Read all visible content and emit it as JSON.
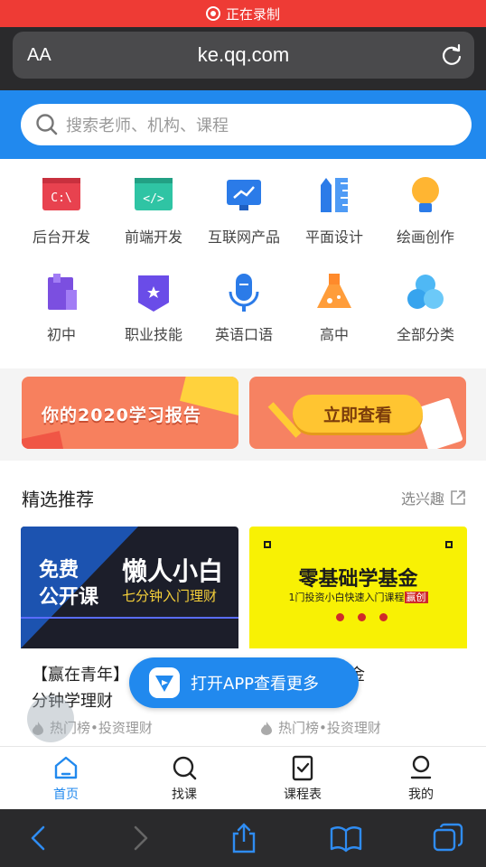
{
  "status_bar": {
    "recording_label": "正在录制",
    "color": "#ee3b35"
  },
  "browser": {
    "text_size_label": "AA",
    "url": "ke.qq.com"
  },
  "search": {
    "placeholder": "搜索老师、机构、课程"
  },
  "categories": [
    {
      "label": "后台开发",
      "icon": "terminal-icon"
    },
    {
      "label": "前端开发",
      "icon": "code-icon"
    },
    {
      "label": "互联网产品",
      "icon": "chart-icon"
    },
    {
      "label": "平面设计",
      "icon": "ruler-icon"
    },
    {
      "label": "绘画创作",
      "icon": "bulb-icon"
    },
    {
      "label": "初中",
      "icon": "book-icon"
    },
    {
      "label": "职业技能",
      "icon": "badge-icon"
    },
    {
      "label": "英语口语",
      "icon": "microphone-icon"
    },
    {
      "label": "高中",
      "icon": "flask-icon"
    },
    {
      "label": "全部分类",
      "icon": "cluster-icon"
    }
  ],
  "banners": {
    "report": "你的2020学习报告",
    "view_button": "立即查看"
  },
  "feed": {
    "title": "精选推荐",
    "more_label": "选兴趣",
    "cards": [
      {
        "thumb_left_1": "免费",
        "thumb_left_2": "公开课",
        "thumb_right_1": "懒人小白",
        "thumb_right_2": "七分钟入门理财",
        "title_line1": "【赢在青年】",
        "title_line2": "分钟学理财",
        "tag": "热门榜•投资理财"
      },
      {
        "thumb_title": "零基础学基金",
        "thumb_sub": "1门投资小白快速入门课程",
        "thumb_badge": "赢创",
        "title_line1": "金",
        "tag": "热门榜•投资理财"
      }
    ]
  },
  "open_app": {
    "label": "打开APP查看更多"
  },
  "tabbar": [
    {
      "label": "首页",
      "icon": "home-icon",
      "active": true
    },
    {
      "label": "找课",
      "icon": "search-icon",
      "active": false
    },
    {
      "label": "课程表",
      "icon": "schedule-icon",
      "active": false
    },
    {
      "label": "我的",
      "icon": "profile-icon",
      "active": false
    }
  ],
  "colors": {
    "accent": "#2189ee",
    "banner": "#f7805e",
    "dark_chrome": "#2a2a2c"
  }
}
